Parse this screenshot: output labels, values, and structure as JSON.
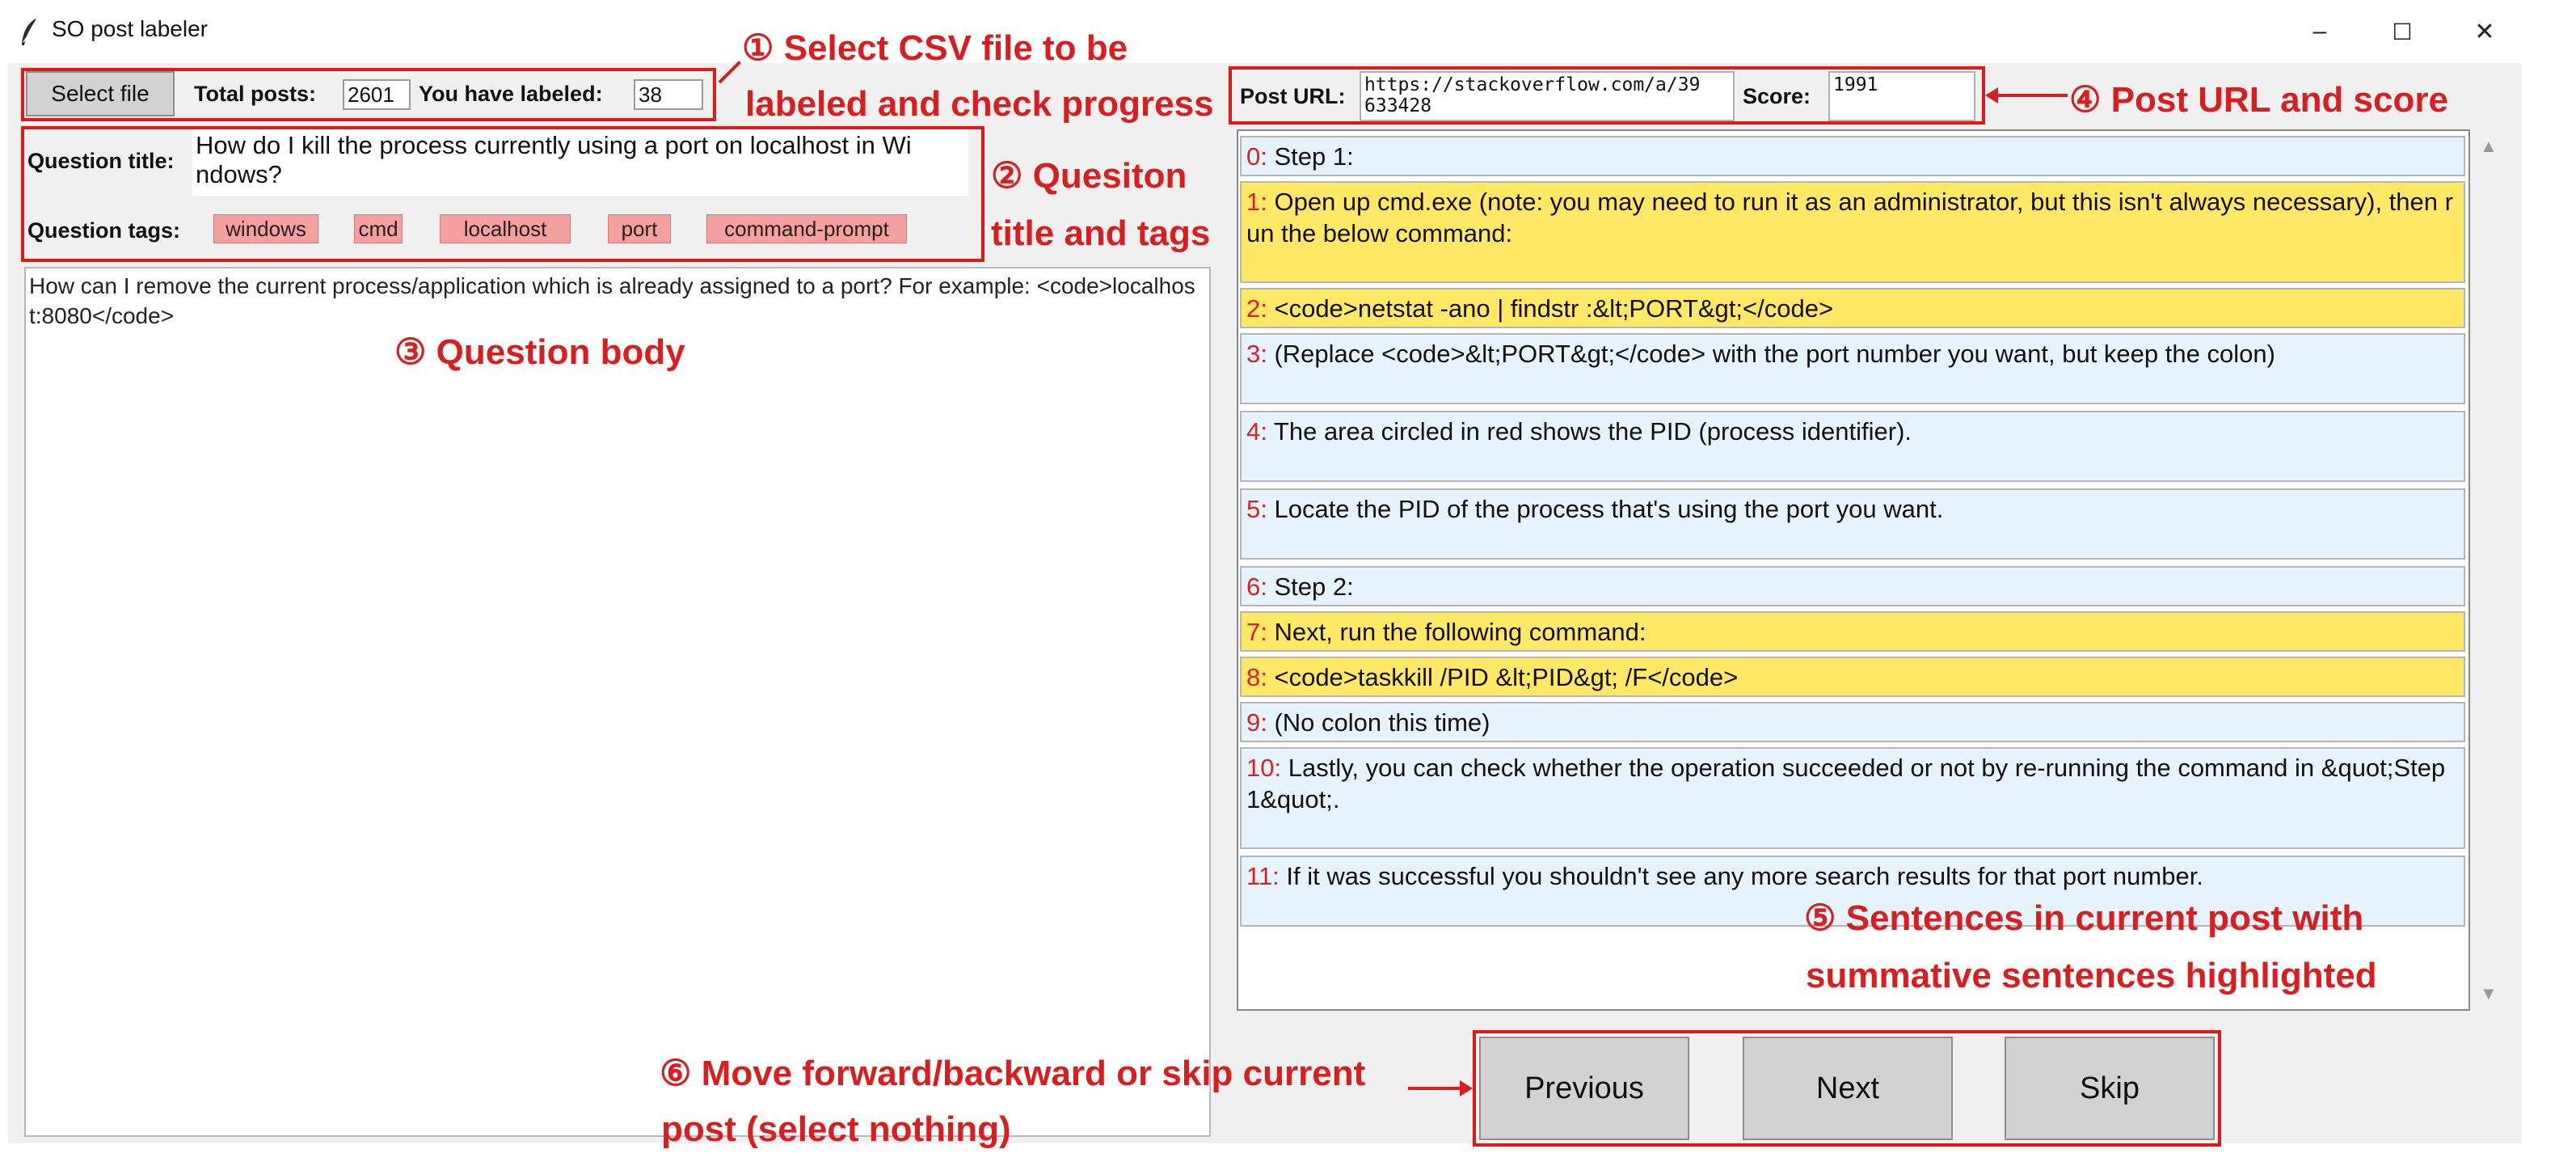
{
  "window": {
    "title": "SO post labeler",
    "minimize": "–",
    "maximize": "☐",
    "close": "✕"
  },
  "toolbar": {
    "select_file_label": "Select file",
    "total_posts_label": "Total posts:",
    "total_posts_value": "2601",
    "labeled_label": "You have labeled:",
    "labeled_value": "38"
  },
  "question": {
    "title_label": "Question title:",
    "title_line1": "How do I kill the process currently using a port on localhost in Wi",
    "title_line2": "ndows?",
    "tags_label": "Question tags:",
    "tags": [
      "windows",
      "cmd",
      "localhost",
      "port",
      "command-prompt"
    ],
    "body": "How can I remove the current process/application which is already assigned to a port? For example: <code>localhost:8080</code>"
  },
  "post": {
    "url_label": "Post URL:",
    "url_line1": "https://stackoverflow.com/a/39",
    "url_line2": "633428",
    "score_label": "Score:",
    "score_value": "1991"
  },
  "sentences": [
    {
      "idx": "0:",
      "text": " Step 1:",
      "highlighted": false
    },
    {
      "idx": "1:",
      "text": " Open up cmd.exe (note: you may need to run it as an administrator, but this isn't always necessary), then run the below command:",
      "highlighted": true
    },
    {
      "idx": "2:",
      "text": " <code>netstat -ano | findstr :&lt;PORT&gt;</code>",
      "highlighted": true
    },
    {
      "idx": "3:",
      "text": " (Replace <code>&lt;PORT&gt;</code> with the port number you want, but keep the colon)",
      "highlighted": false
    },
    {
      "idx": "4:",
      "text": " The area circled in red shows the PID (process identifier).",
      "highlighted": false
    },
    {
      "idx": "5:",
      "text": " Locate the PID of the process that's using the port you want.",
      "highlighted": false
    },
    {
      "idx": "6:",
      "text": " Step 2:",
      "highlighted": false
    },
    {
      "idx": "7:",
      "text": " Next, run the following command:",
      "highlighted": true
    },
    {
      "idx": "8:",
      "text": " <code>taskkill /PID &lt;PID&gt; /F</code>",
      "highlighted": true
    },
    {
      "idx": "9:",
      "text": " (No colon this time)",
      "highlighted": false
    },
    {
      "idx": "10:",
      "text": " Lastly, you can check whether the operation succeeded or not by re-running the command in &quot;Step 1&quot;.",
      "highlighted": false
    },
    {
      "idx": "11:",
      "text": " If it was successful you shouldn't see any more search results for that port number.",
      "highlighted": false
    }
  ],
  "nav": {
    "previous_label": "Previous",
    "next_label": "Next",
    "skip_label": "Skip"
  },
  "annotations": {
    "a1_line1": "① Select CSV file to be",
    "a1_line2": "labeled and check progress",
    "a2_line1": "② Quesiton",
    "a2_line2": "title and tags",
    "a3": "③ Question body",
    "a4": "④ Post URL and score",
    "a5_line1": "⑤ Sentences in current post with",
    "a5_line2": "summative sentences highlighted",
    "a6_line1": "⑥ Move forward/backward or skip current",
    "a6_line2": "post (select nothing)"
  },
  "colors": {
    "annotation_red": "#d81e1e",
    "highlight_yellow": "#ffe866",
    "sentence_blue": "#e6f3fc",
    "tag_pink": "#f4a0a0"
  },
  "icons": {
    "app": "feather-icon",
    "scroll_up": "scroll-up-arrow-icon",
    "scroll_down": "scroll-down-arrow-icon"
  }
}
